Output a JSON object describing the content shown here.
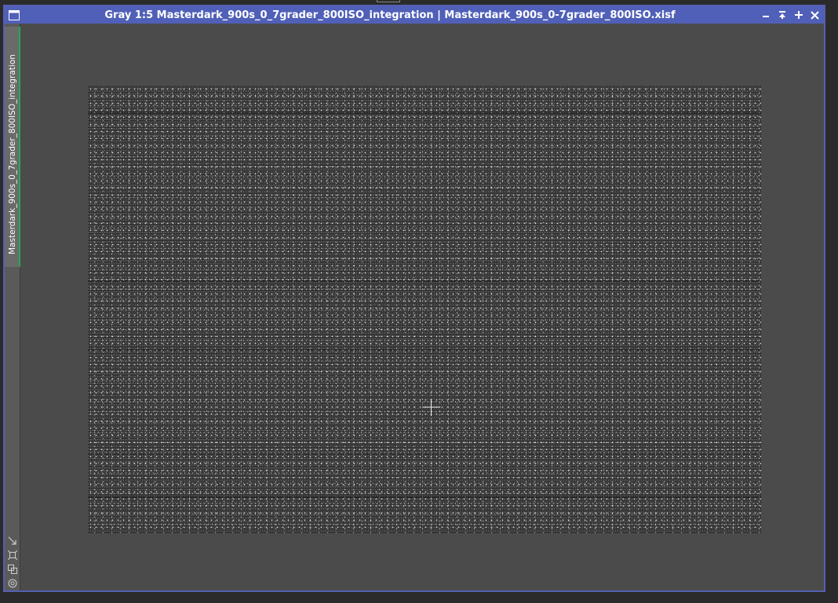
{
  "window": {
    "title": "Gray 1:5 Masterdark_900s_0_7grader_800ISO_integration | Masterdark_900s_0-7grader_800ISO.xisf",
    "icon": "image-window-icon",
    "buttons": {
      "minimize": "minimize-icon",
      "shade": "shade-icon",
      "maximize": "maximize-icon",
      "close": "close-icon"
    }
  },
  "view_tab": {
    "label": "Masterdark_900s_0_7grader_800ISO_integration"
  },
  "strip_tools": [
    "resize-arrow-icon",
    "fit-view-icon",
    "clone-icon",
    "preview-icon"
  ],
  "colors": {
    "titlebar": "#5060b8",
    "window_border": "#5560b0",
    "canvas_bg": "#4b4b4b",
    "image_bg": "#3a3a3a",
    "tab_accent": "#22aa55"
  }
}
